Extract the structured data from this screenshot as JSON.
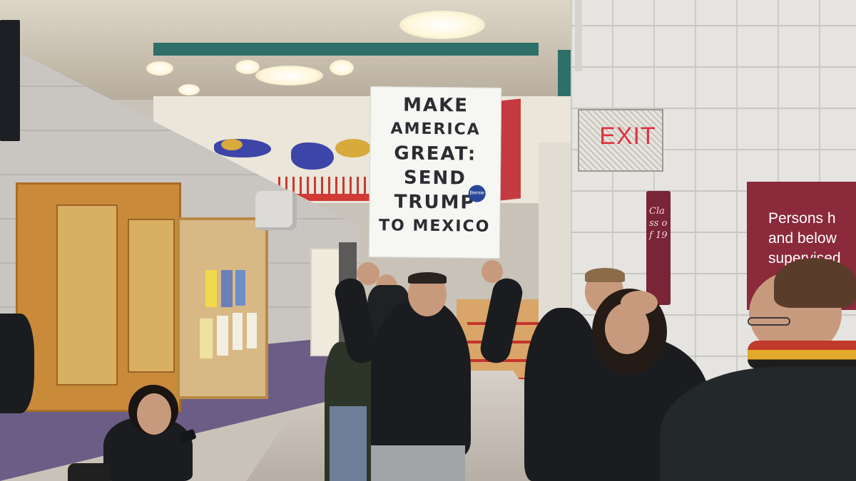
{
  "scene": {
    "exit_sign": "EXIT",
    "protest_sign": {
      "lines": [
        "MAKE",
        "AMERICA",
        "GREAT:",
        "SEND",
        "TRUMP",
        "TO MEXICO"
      ],
      "sticker": "Bernie"
    },
    "hallway_sign": {
      "text": "Persons h\nand below\nsupervised"
    },
    "banner_text": "Class of 19",
    "colors": {
      "sign_background": "#f6f6f3",
      "sign_ink": "#2c2d33",
      "exit_red": "#e03240",
      "hallway_sign_maroon": "#8a2a3a",
      "sticker_blue": "#28479a"
    }
  }
}
